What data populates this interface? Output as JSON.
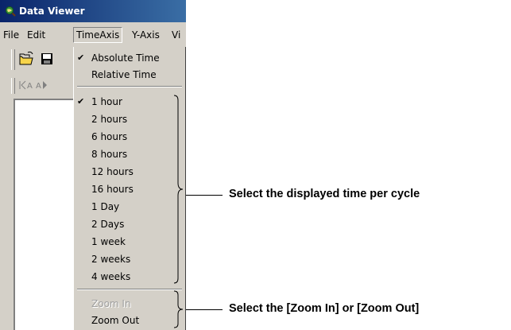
{
  "window": {
    "title": "Data Viewer",
    "icon": "magnifier-globe-icon"
  },
  "menubar": {
    "items": [
      "File",
      "Edit",
      "TimeAxis",
      "Y-Axis",
      "Vi"
    ],
    "open_index": 2
  },
  "toolbar": {
    "buttons": [
      "open-folder-icon",
      "save-icon"
    ]
  },
  "toolbar2": {
    "buttons": [
      "first-page-icon",
      "previous-icon"
    ]
  },
  "timeaxis_menu": {
    "mode_items": [
      {
        "label": "Absolute Time",
        "checked": true
      },
      {
        "label": "Relative Time",
        "checked": false
      }
    ],
    "span_items": [
      {
        "label": "1 hour",
        "checked": true
      },
      {
        "label": "2 hours"
      },
      {
        "label": "6 hours"
      },
      {
        "label": "8 hours"
      },
      {
        "label": "12 hours"
      },
      {
        "label": "16 hours"
      },
      {
        "label": "1 Day"
      },
      {
        "label": "2 Days"
      },
      {
        "label": "1 week"
      },
      {
        "label": "2 weeks"
      },
      {
        "label": "4 weeks"
      }
    ],
    "zoom_items": [
      {
        "label": "Zoom In",
        "disabled": true
      },
      {
        "label": "Zoom Out",
        "disabled": false
      }
    ]
  },
  "annotations": {
    "span_note": "Select the displayed time per cycle",
    "zoom_note": "Select the [Zoom In] or [Zoom Out]"
  },
  "colors": {
    "titlebar_start": "#0a246a",
    "titlebar_end": "#3a6ea5",
    "face": "#d4d0c8"
  }
}
